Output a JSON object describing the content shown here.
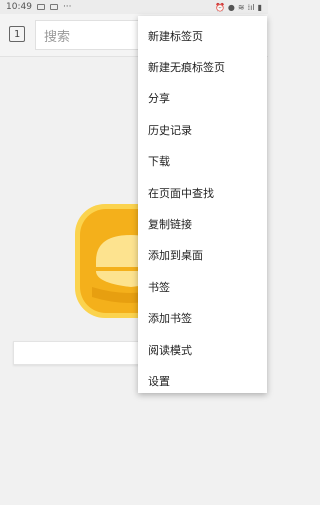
{
  "status_bar": {
    "time": "10:49",
    "dots": "···",
    "signal": "⁞ıl"
  },
  "toolbar": {
    "tab_count": "1",
    "search_placeholder": "搜索"
  },
  "menu": {
    "items": [
      {
        "label": "新建标签页"
      },
      {
        "label": "新建无痕标签页"
      },
      {
        "label": "分享"
      },
      {
        "label": "历史记录"
      },
      {
        "label": "下载"
      },
      {
        "label": "在页面中查找"
      },
      {
        "label": "复制链接"
      },
      {
        "label": "添加到桌面"
      },
      {
        "label": "书签"
      },
      {
        "label": "添加书签"
      },
      {
        "label": "阅读模式"
      },
      {
        "label": "设置"
      }
    ]
  },
  "colors": {
    "logo_yellow": "#f7b81e",
    "logo_light": "#fde08a",
    "menu_bg": "#ffffff"
  }
}
